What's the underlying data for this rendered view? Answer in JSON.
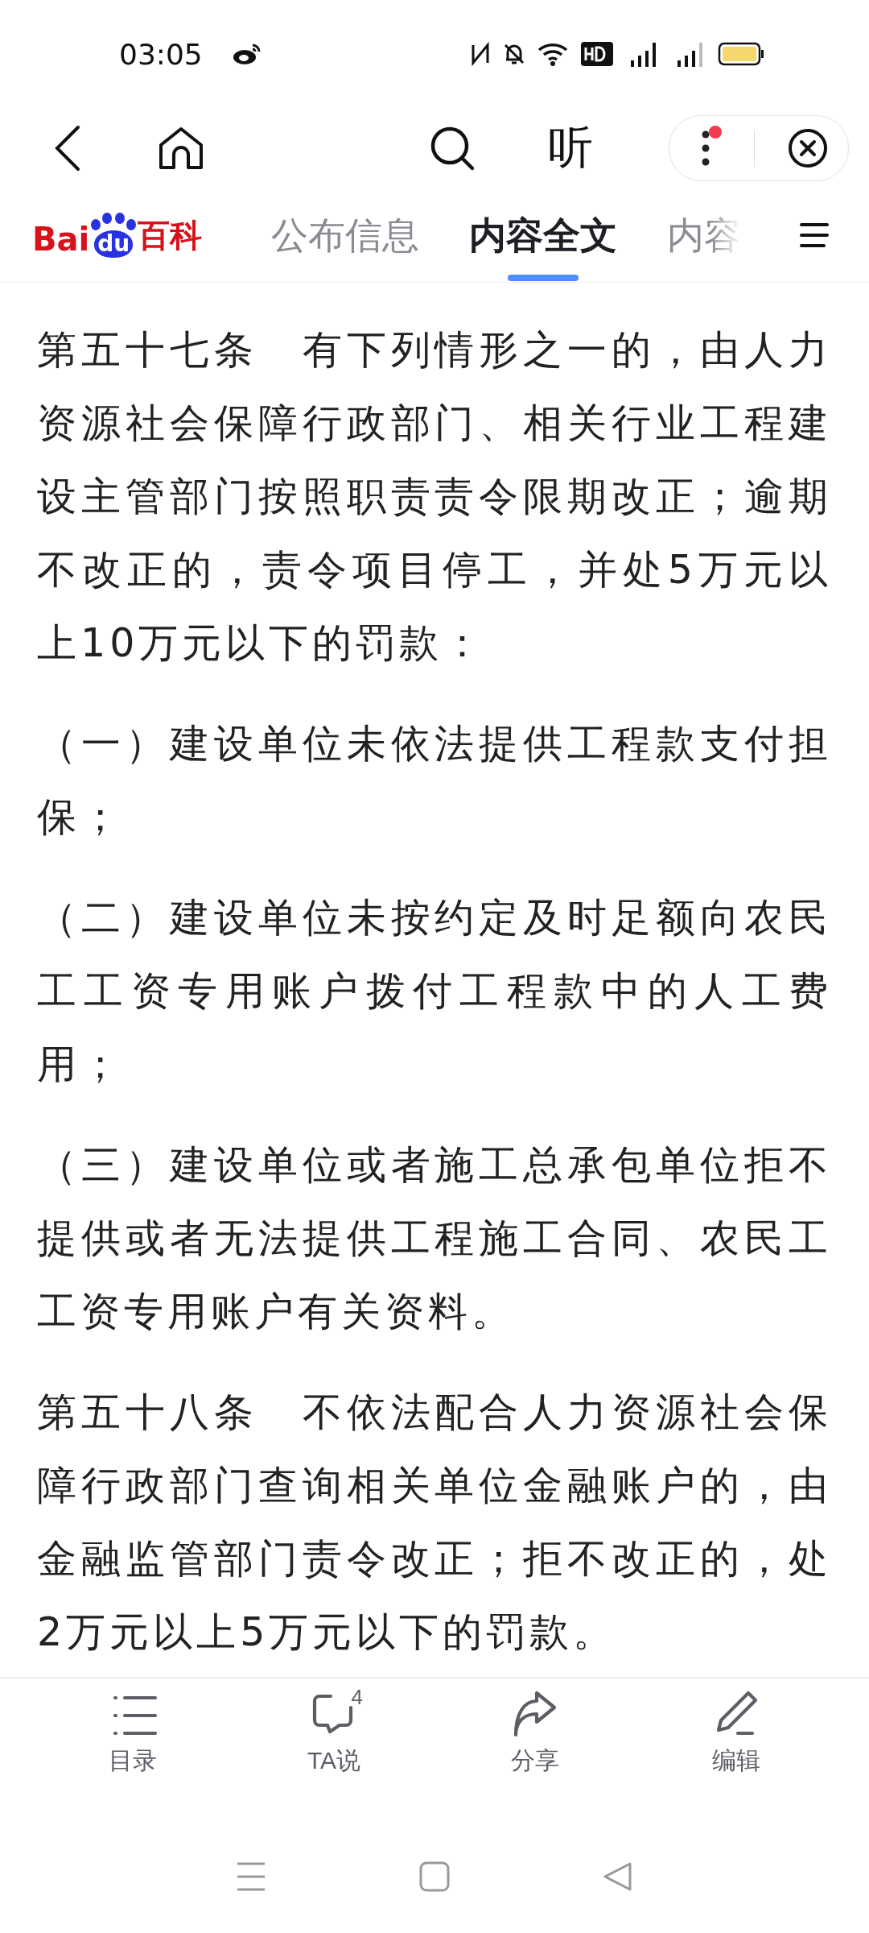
{
  "status_bar": {
    "time": "03:05"
  },
  "toolbar": {
    "listen_label": "听",
    "menu_has_notification": true
  },
  "tabs": [
    {
      "label": "公布信息",
      "selected": false
    },
    {
      "label": "内容全文",
      "selected": true
    },
    {
      "label": "内容",
      "selected": false
    }
  ],
  "logo": {
    "text_left": "Bai",
    "text_paw": "du",
    "text_right": "百科"
  },
  "paragraphs": [
    "第五十七条　有下列情形之一的，由人力资源社会保障行政部门、相关行业工程建设主管部门按照职责责令限期改正；逾期不改正的，责令项目停工，并处5万元以上10万元以下的罚款：",
    "（一）建设单位未依法提供工程款支付担保；",
    "（二）建设单位未按约定及时足额向农民工工资专用账户拨付工程款中的人工费用；",
    "（三）建设单位或者施工总承包单位拒不提供或者无法提供工程施工合同、农民工工资专用账户有关资料。",
    "第五十八条　不依法配合人力资源社会保障行政部门查询相关单位金融账户的，由金融监管部门责令改正；拒不改正的，处2万元以上5万元以下的罚款。"
  ],
  "bottom_nav": [
    {
      "kind": "catalog",
      "label": "目录"
    },
    {
      "kind": "comments",
      "label": "TA说",
      "badge": "4"
    },
    {
      "kind": "share",
      "label": "分享"
    },
    {
      "kind": "edit",
      "label": "编辑"
    }
  ]
}
